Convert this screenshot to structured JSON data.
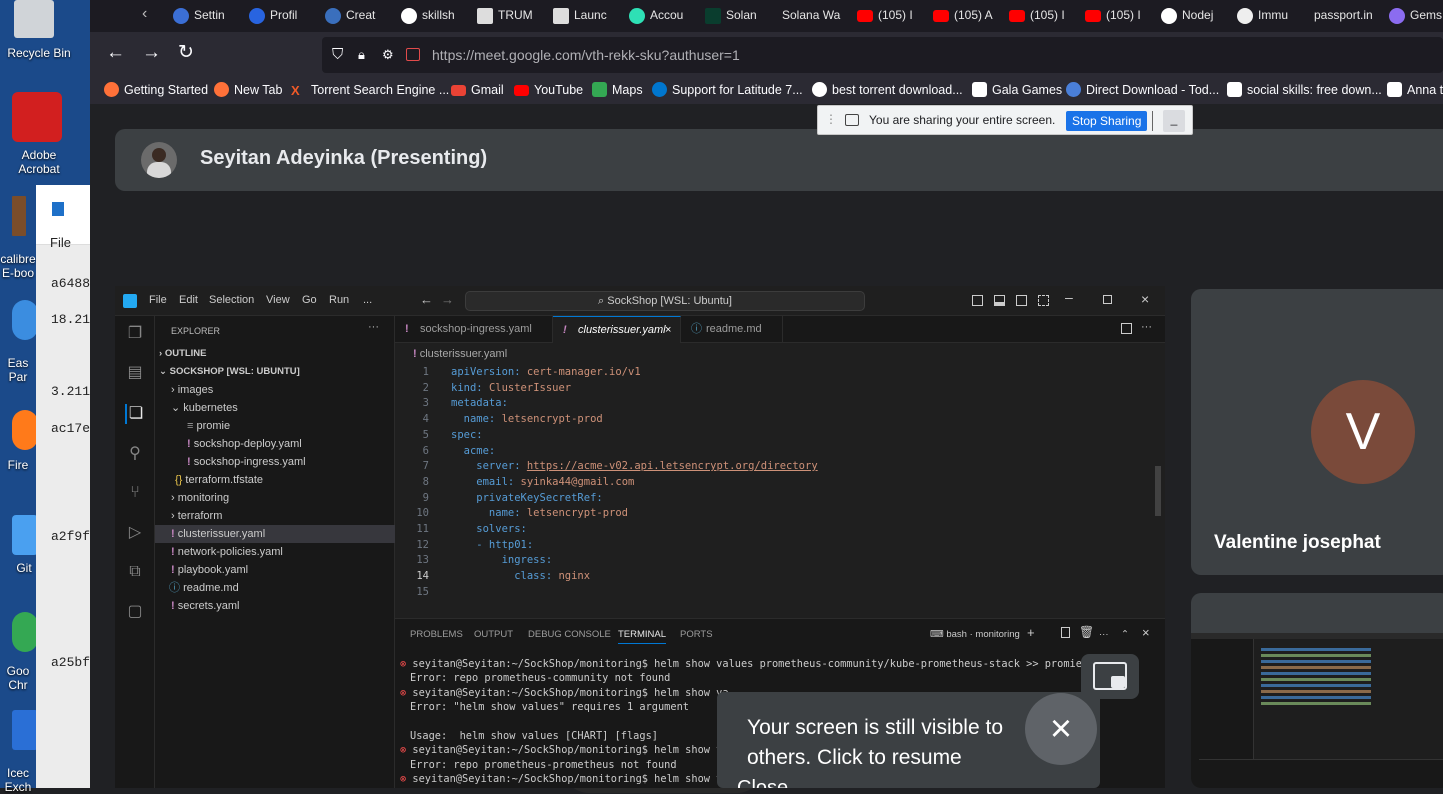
{
  "desktop": {
    "icons": [
      {
        "label": "Recycle Bin",
        "icon": "recycle-bin-icon"
      },
      {
        "label": "Adobe Acrobat",
        "icon": "acrobat-icon"
      },
      {
        "label": "calibre E-boo",
        "icon": "calibre-icon"
      },
      {
        "label": "Eas Par",
        "icon": "app-icon"
      },
      {
        "label": "Fire",
        "icon": "firefox-icon"
      },
      {
        "label": "Git",
        "icon": "git-icon"
      },
      {
        "label": "Goo Chr",
        "icon": "chrome-icon"
      },
      {
        "label": "Icec Exch",
        "icon": "app-icon"
      }
    ],
    "left_window": {
      "menu": "File",
      "lines": [
        "a6488",
        "18.21",
        "3.211",
        "ac17e",
        "a2f9f",
        "a25bf"
      ]
    }
  },
  "browser": {
    "tabs": [
      "Settin",
      "Profil",
      "Creat",
      "skillsh",
      "TRUM",
      "Launc",
      "Accou",
      "Solan",
      "Solana Wa",
      "(105) I",
      "(105) A",
      "(105) I",
      "(105) I",
      "Nodej",
      "Immu",
      "passport.in",
      "Gems"
    ],
    "url": "https://meet.google.com/vth-rekk-sku?authuser=1",
    "url_host": "meet.google.com",
    "bookmarks": [
      "Getting Started",
      "New Tab",
      "Torrent Search Engine ...",
      "Gmail",
      "YouTube",
      "Maps",
      "Support for Latitude 7...",
      "best torrent download...",
      "Gala Games",
      "Direct Download - Tod...",
      "social skills: free down...",
      "Anna t"
    ]
  },
  "meet": {
    "presenter": "Seyitan Adeyinka (Presenting)",
    "share_bar": {
      "message": "You are sharing your entire screen.",
      "stop_label": "Stop Sharing",
      "hide_label": "_"
    },
    "participant": {
      "initial": "V",
      "name": "Valentine josephat"
    },
    "notice": {
      "text": "Your screen is still visible to others. Click to resume",
      "partial": "Close"
    }
  },
  "vscode": {
    "menus": [
      "File",
      "Edit",
      "Selection",
      "View",
      "Go",
      "Run",
      "..."
    ],
    "search": "SockShop [WSL: Ubuntu]",
    "explorer_title": "EXPLORER",
    "outline": "OUTLINE",
    "workspace": "SOCKSHOP [WSL: UBUNTU]",
    "tree": [
      {
        "label": "images",
        "indent": 1,
        "kind": "folder"
      },
      {
        "label": "kubernetes",
        "indent": 1,
        "kind": "folder-open"
      },
      {
        "label": "promie",
        "indent": 2,
        "kind": "file"
      },
      {
        "label": "sockshop-deploy.yaml",
        "indent": 2,
        "kind": "yaml"
      },
      {
        "label": "sockshop-ingress.yaml",
        "indent": 2,
        "kind": "yaml"
      },
      {
        "label": "terraform.tfstate",
        "indent": 1,
        "kind": "json"
      },
      {
        "label": "monitoring",
        "indent": 1,
        "kind": "folder"
      },
      {
        "label": "terraform",
        "indent": 1,
        "kind": "folder"
      },
      {
        "label": "clusterissuer.yaml",
        "indent": 1,
        "kind": "yaml",
        "selected": true
      },
      {
        "label": "network-policies.yaml",
        "indent": 1,
        "kind": "yaml"
      },
      {
        "label": "playbook.yaml",
        "indent": 1,
        "kind": "yaml"
      },
      {
        "label": "readme.md",
        "indent": 1,
        "kind": "md"
      },
      {
        "label": "secrets.yaml",
        "indent": 1,
        "kind": "yaml"
      }
    ],
    "editor_tabs": [
      "sockshop-ingress.yaml",
      "clusterissuer.yaml",
      "readme.md"
    ],
    "breadcrumb": "clusterissuer.yaml",
    "code": [
      [
        "apiVersion: ",
        "cert-manager.io/v1"
      ],
      [
        "kind: ",
        "ClusterIssuer"
      ],
      [
        "metadata:",
        ""
      ],
      [
        "  name: ",
        "letsencrypt-prod"
      ],
      [
        "spec:",
        ""
      ],
      [
        "  acme:",
        ""
      ],
      [
        "    server: ",
        "https://acme-v02.api.letsencrypt.org/directory"
      ],
      [
        "    email: ",
        "syinka44@gmail.com"
      ],
      [
        "    privateKeySecretRef:",
        ""
      ],
      [
        "      name: ",
        "letsencrypt-prod"
      ],
      [
        "    solvers:",
        ""
      ],
      [
        "    - http01:",
        ""
      ],
      [
        "        ingress:",
        ""
      ],
      [
        "          class: ",
        "nginx"
      ],
      [
        "",
        ""
      ]
    ],
    "panel_tabs": [
      "PROBLEMS",
      "OUTPUT",
      "DEBUG CONSOLE",
      "TERMINAL",
      "PORTS"
    ],
    "terminal_name": "bash · monitoring",
    "terminal": [
      {
        "dot": true,
        "text": "seyitan@Seyitan:~/SockShop/monitoring$ helm show values prometheus-community/kube-prometheus-stack >> promie"
      },
      {
        "dot": false,
        "text": "Error: repo prometheus-community not found"
      },
      {
        "dot": true,
        "text": "seyitan@Seyitan:~/SockShop/monitoring$ helm show va"
      },
      {
        "dot": false,
        "text": "Error: \"helm show values\" requires 1 argument"
      },
      {
        "dot": false,
        "text": ""
      },
      {
        "dot": false,
        "text": "Usage:  helm show values [CHART] [flags]"
      },
      {
        "dot": true,
        "text": "seyitan@Seyitan:~/SockShop/monitoring$ helm show va"
      },
      {
        "dot": false,
        "text": "Error: repo prometheus-prometheus not found"
      },
      {
        "dot": true,
        "text": "seyitan@Seyitan:~/SockShop/monitoring$ helm show va"
      }
    ]
  }
}
